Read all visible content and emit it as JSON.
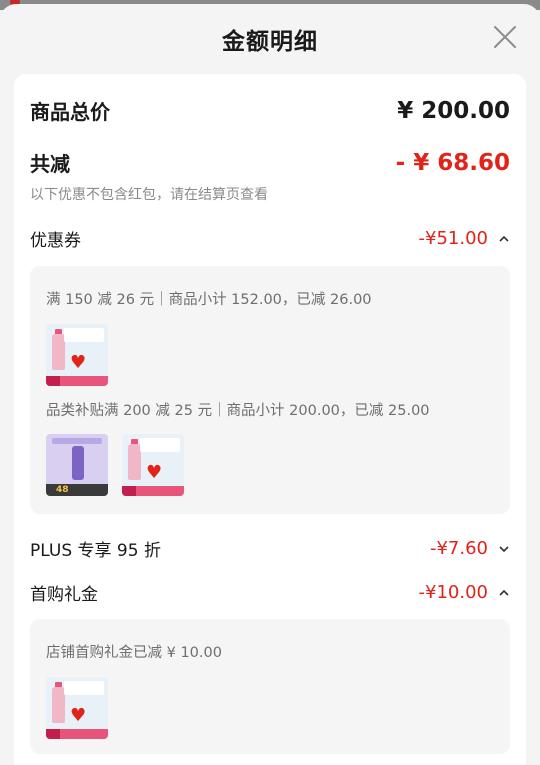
{
  "modal": {
    "title": "金额明细"
  },
  "summary": {
    "total_label": "商品总价",
    "total_value": "¥ 200.00",
    "reduce_label": "共减",
    "reduce_value": "- ¥ 68.60",
    "note": "以下优惠不包含红包，请在结算页查看"
  },
  "coupon": {
    "label": "优惠券",
    "amount": "-¥51.00",
    "expanded": true,
    "line1": "满 150 减 26 元｜商品小计 152.00，已减 26.00",
    "line2": "品类补贴满 200 减 25 元｜商品小计 200.00，已减 25.00",
    "thumb_purple_price": "48"
  },
  "plus": {
    "label": "PLUS 专享 95 折",
    "amount": "-¥7.60",
    "expanded": false
  },
  "first_buy": {
    "label": "首购礼金",
    "amount": "-¥10.00",
    "expanded": true,
    "line1": "店铺首购礼金已减 ¥ 10.00"
  },
  "colors": {
    "accent": "#e2231a",
    "muted": "#8a8a8a"
  },
  "icons": [
    "close-icon",
    "chevron-up-icon",
    "chevron-down-icon"
  ]
}
